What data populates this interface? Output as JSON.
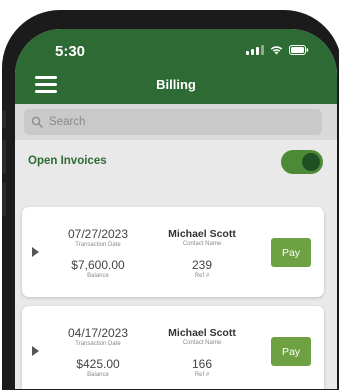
{
  "status_bar": {
    "time": "5:30"
  },
  "header": {
    "title": "Billing"
  },
  "search": {
    "placeholder": "Search"
  },
  "filter": {
    "label": "Open Invoices",
    "toggle_on": true
  },
  "invoices": [
    {
      "date": "07/27/2023",
      "date_label": "Transaction Date",
      "balance": "$7,600.00",
      "balance_label": "Balance",
      "contact_name": "Michael Scott",
      "contact_label": "Contact Name",
      "ref": "239",
      "ref_label": "Ref #",
      "pay_label": "Pay"
    },
    {
      "date": "04/17/2023",
      "date_label": "Transaction Date",
      "balance": "$425.00",
      "balance_label": "Balance",
      "contact_name": "Michael Scott",
      "contact_label": "Contact Name",
      "ref": "166",
      "ref_label": "Ref #",
      "pay_label": "Pay"
    }
  ],
  "colors": {
    "header_green": "#2e6b34",
    "toggle_green": "#4d8a35",
    "pay_green": "#6ea142"
  }
}
